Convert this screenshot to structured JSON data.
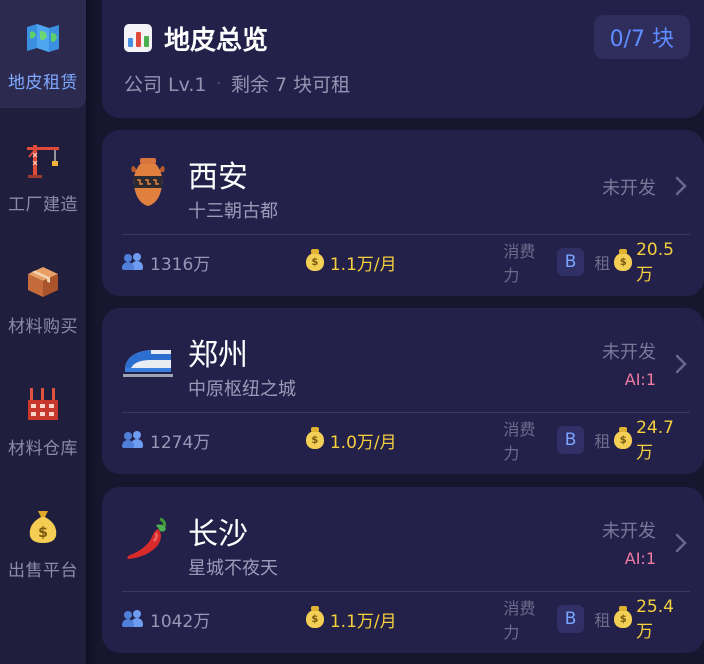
{
  "sidebar": {
    "items": [
      {
        "label": "地皮租赁",
        "icon": "map-icon",
        "active": true
      },
      {
        "label": "工厂建造",
        "icon": "crane-icon",
        "active": false
      },
      {
        "label": "材料购买",
        "icon": "package-icon",
        "active": false
      },
      {
        "label": "材料仓库",
        "icon": "factory-icon",
        "active": false
      },
      {
        "label": "出售平台",
        "icon": "money-bag-icon",
        "active": false
      }
    ]
  },
  "header": {
    "title": "地皮总览",
    "count": "0/7 块",
    "company": "公司 Lv.1",
    "separator": "·",
    "remaining": "剩余 7 块可租"
  },
  "cities": [
    {
      "name": "西安",
      "desc": "十三朝古都",
      "status": "未开发",
      "ai": "",
      "icon": "amphora-icon",
      "population": "1316万",
      "rent": "1.1万/月",
      "consume_label": "消费力",
      "grade": "B",
      "rent_total_label": "租",
      "rent_total": "20.5万"
    },
    {
      "name": "郑州",
      "desc": "中原枢纽之城",
      "status": "未开发",
      "ai": "AI:1",
      "icon": "bullet-train-icon",
      "population": "1274万",
      "rent": "1.0万/月",
      "consume_label": "消费力",
      "grade": "B",
      "rent_total_label": "租",
      "rent_total": "24.7万"
    },
    {
      "name": "长沙",
      "desc": "星城不夜天",
      "status": "未开发",
      "ai": "AI:1",
      "icon": "chili-pepper-icon",
      "population": "1042万",
      "rent": "1.1万/月",
      "consume_label": "消费力",
      "grade": "B",
      "rent_total_label": "租",
      "rent_total": "25.4万"
    }
  ],
  "colors": {
    "background": "#17162e",
    "card": "#23214a",
    "accent": "#5f8cff",
    "gold": "#f6cf3d",
    "ai_pink": "#f07aa0"
  }
}
